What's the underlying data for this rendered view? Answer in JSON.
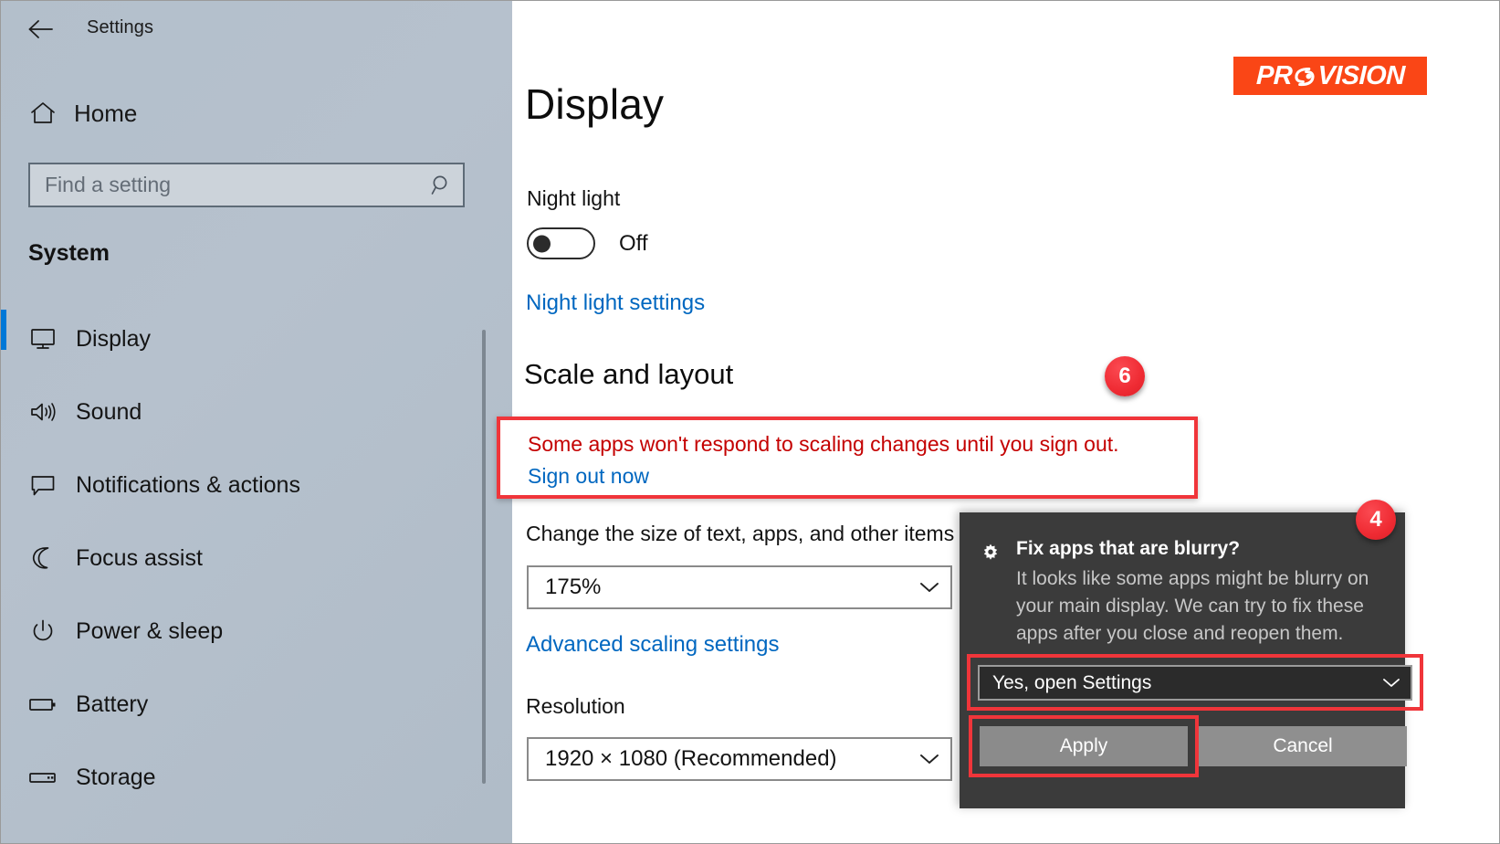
{
  "window": {
    "app_title": "Settings",
    "back_icon": "back-arrow-icon"
  },
  "sidebar": {
    "home": {
      "label": "Home",
      "icon": "home-icon"
    },
    "search": {
      "placeholder": "Find a setting",
      "value": "",
      "icon": "search-icon"
    },
    "section_title": "System",
    "items": [
      {
        "label": "Display",
        "icon": "monitor-icon",
        "selected": true
      },
      {
        "label": "Sound",
        "icon": "speaker-icon",
        "selected": false
      },
      {
        "label": "Notifications & actions",
        "icon": "chat-bubble-icon",
        "selected": false
      },
      {
        "label": "Focus assist",
        "icon": "moon-icon",
        "selected": false
      },
      {
        "label": "Power & sleep",
        "icon": "power-icon",
        "selected": false
      },
      {
        "label": "Battery",
        "icon": "battery-icon",
        "selected": false
      },
      {
        "label": "Storage",
        "icon": "storage-icon",
        "selected": false
      }
    ]
  },
  "main": {
    "page_title": "Display",
    "logo": {
      "text_left": "PR",
      "swoosh": "provision-swoosh-icon",
      "text_right": "VISION",
      "background_color": "#fa4616"
    },
    "night_light": {
      "label": "Night light",
      "toggle_state": "Off",
      "settings_link": "Night light settings"
    },
    "scale_and_layout": {
      "heading": "Scale and layout",
      "warning_text": "Some apps won't respond to scaling changes until you sign out.",
      "sign_out_link": "Sign out now",
      "change_size_label": "Change the size of text, apps, and other items",
      "scale_value": "175%",
      "advanced_link": "Advanced scaling settings"
    },
    "resolution": {
      "label": "Resolution",
      "value": "1920 × 1080 (Recommended)"
    }
  },
  "blurry_dialog": {
    "gear_icon": "gear-icon",
    "title": "Fix apps that are blurry?",
    "body": "It looks like some apps might be blurry on your main display. We can try to fix these apps after you close and reopen them.",
    "dropdown_value": "Yes, open Settings",
    "apply_label": "Apply",
    "cancel_label": "Cancel"
  },
  "annotations": {
    "badges": [
      {
        "number": "6",
        "target": "scale-and-layout-warning"
      },
      {
        "number": "4",
        "target": "blurry-dialog"
      }
    ],
    "highlight_color": "#f0353a"
  }
}
